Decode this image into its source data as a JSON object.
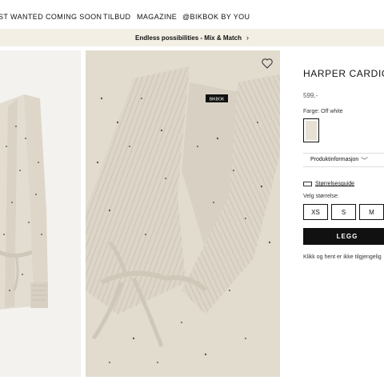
{
  "nav": {
    "items": [
      "ST WANTED",
      "COMING SOON",
      "TILBUD",
      "MAGAZINE",
      "@BIKBOK BY YOU"
    ]
  },
  "promo": {
    "text": "Endless possibilities - Mix & Match",
    "chevron": "›"
  },
  "product": {
    "title": "HARPER CARDIG",
    "price": "599,-",
    "color_label": "Farge: Off white",
    "info_label": "Produktinformasjon",
    "info_chevron": "﹀",
    "size_guide": "Størrelsesguide",
    "size_label": "Velg størrelse:",
    "sizes": [
      "XS",
      "S",
      "M"
    ],
    "cta": "LEGG",
    "pickup": "Klikk og hent er ikke tilgjengelig"
  },
  "images": {
    "brand_tag": "BIKBOK"
  },
  "icons": {
    "wishlist": "heart-icon",
    "size_guide": "ruler-icon",
    "promo": "chevron-right-icon",
    "info": "chevron-down-icon"
  },
  "colors": {
    "promo_bg": "#f3efe4",
    "cta_bg": "#111111",
    "knit": "#e2dccf"
  }
}
